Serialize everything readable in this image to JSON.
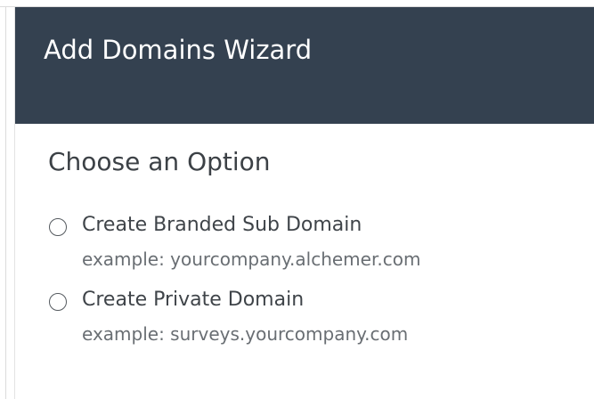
{
  "wizard": {
    "title": "Add Domains Wizard",
    "section_title": "Choose an Option",
    "options": [
      {
        "label": "Create Branded Sub Domain",
        "example": "example: yourcompany.alchemer.com",
        "selected": false
      },
      {
        "label": "Create Private Domain",
        "example": "example: surveys.yourcompany.com",
        "selected": false
      }
    ]
  },
  "colors": {
    "header_background": "#344150",
    "header_text": "#ffffff",
    "body_text": "#3f4449",
    "example_text": "#696e73"
  }
}
